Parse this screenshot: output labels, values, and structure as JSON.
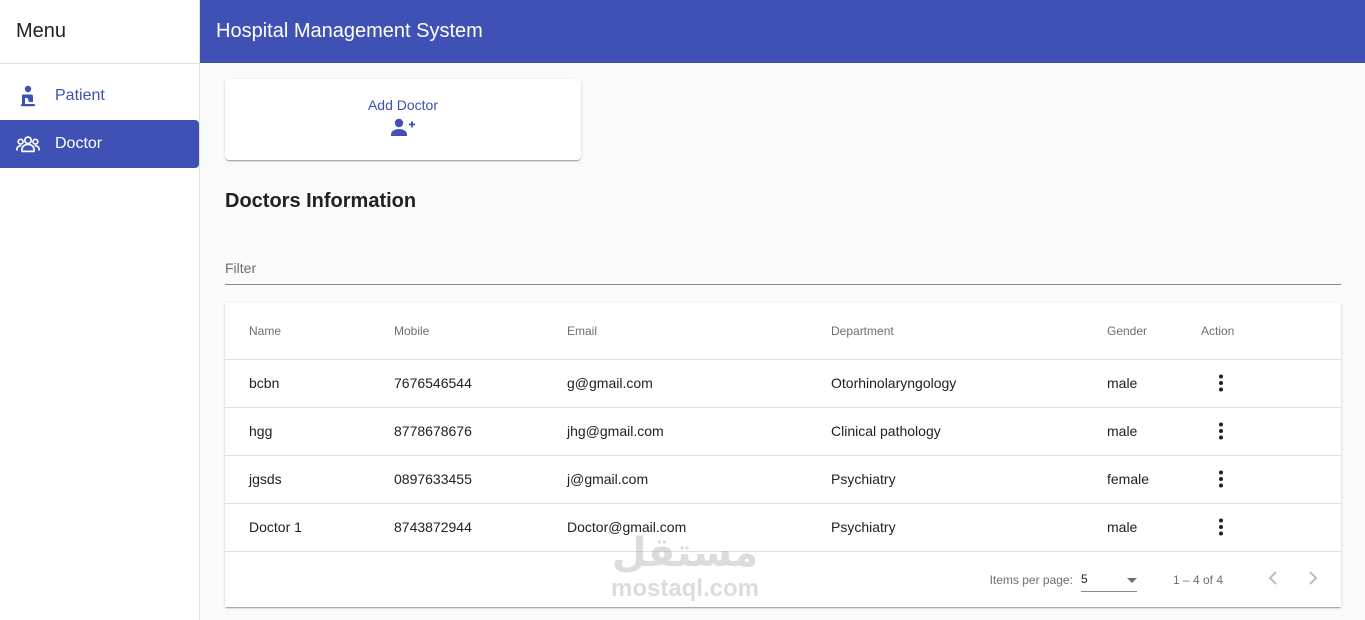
{
  "sidebar": {
    "title": "Menu",
    "items": [
      {
        "label": "Patient",
        "icon": "patient-icon",
        "active": false
      },
      {
        "label": "Doctor",
        "icon": "doctors-group-icon",
        "active": true
      }
    ]
  },
  "header": {
    "title": "Hospital Management System"
  },
  "add_doctor": {
    "label": "Add Doctor",
    "icon": "person-add-icon"
  },
  "section_title": "Doctors Information",
  "filter": {
    "placeholder": "Filter",
    "value": ""
  },
  "table": {
    "columns": [
      "Name",
      "Mobile",
      "Email",
      "Department",
      "Gender",
      "Action"
    ],
    "rows": [
      {
        "name": "bcbn",
        "mobile": "7676546544",
        "email": "g@gmail.com",
        "department": "Otorhinolaryngology",
        "gender": "male"
      },
      {
        "name": "hgg",
        "mobile": "8778678676",
        "email": "jhg@gmail.com",
        "department": "Clinical pathology",
        "gender": "male"
      },
      {
        "name": "jgsds",
        "mobile": "0897633455",
        "email": "j@gmail.com",
        "department": "Psychiatry",
        "gender": "female"
      },
      {
        "name": "Doctor 1",
        "mobile": "8743872944",
        "email": "Doctor@gmail.com",
        "department": "Psychiatry",
        "gender": "male"
      }
    ]
  },
  "paginator": {
    "items_per_page_label": "Items per page:",
    "items_per_page": "5",
    "range": "1 – 4 of 4"
  },
  "watermark": {
    "arabic": "مستقل",
    "latin": "mostaql.com"
  },
  "colors": {
    "primary": "#3f51b5",
    "text": "#212121",
    "muted": "#6f6f6f",
    "divider": "#e0e0e0"
  }
}
